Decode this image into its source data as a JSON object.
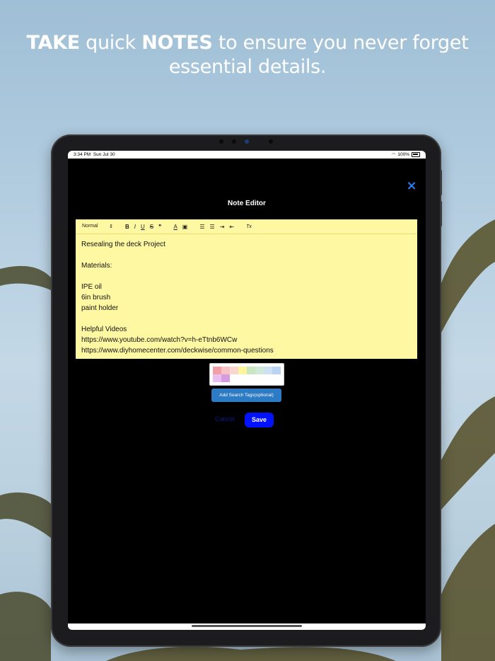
{
  "headline": {
    "part1": "TAKE",
    "part2": " quick ",
    "part3": "NOTES",
    "part4": " to ensure you never forget essential details."
  },
  "status_bar": {
    "time": "3:34 PM",
    "date": "Sun Jul 30",
    "battery": "100%"
  },
  "screen": {
    "close_icon": "×",
    "title": "Note Editor"
  },
  "toolbar": {
    "style_select": "Normal",
    "bold": "B",
    "italic": "I",
    "underline": "U",
    "strike": "S",
    "quote": "❞",
    "font_color": "A",
    "background": "▣",
    "ordered_list": "☰",
    "bullet_list": "☰",
    "indent": "⇥",
    "outdent": "⇤",
    "clear_format": "Tx"
  },
  "note_lines": [
    "Resealing the deck Project",
    "",
    "Materials:",
    "",
    "IPE oil",
    "6in brush",
    "paint holder",
    "",
    "Helpful Videos",
    "https://www.youtube.com/watch?v=h-eTtnb6WCw",
    "https://www.diyhomecenter.com/deckwise/common-questions"
  ],
  "palette_colors": [
    "#f2a0a6",
    "#f6c2c6",
    "#f9d6d0",
    "#fff59a",
    "#c9e6c0",
    "#cfe8d8",
    "#cfe0f2",
    "#b9d3f2",
    "#e8bff0",
    "#d59ae0",
    "#ffffff",
    "#ffffff"
  ],
  "buttons": {
    "add_tags": "Add Search Tags(optional)",
    "cancel": "Cancel",
    "save": "Save"
  },
  "colors": {
    "note_bg": "#fff8a3",
    "save_bg": "#0012ff",
    "tags_bg": "#2c7bc4",
    "close_color": "#2f7cf6"
  }
}
